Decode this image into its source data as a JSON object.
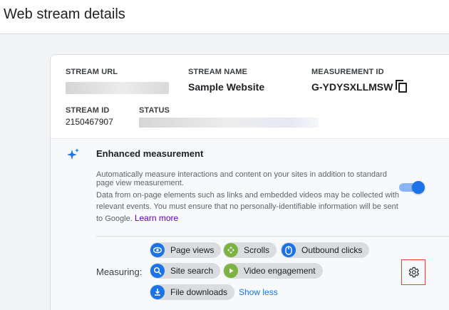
{
  "page": {
    "title": "Web stream details"
  },
  "stream": {
    "url_label": "STREAM URL",
    "name_label": "STREAM NAME",
    "name_value": "Sample Website",
    "measurement_label": "MEASUREMENT ID",
    "measurement_value": "G-YDYSXLLMSW",
    "id_label": "STREAM ID",
    "id_value": "2150467907",
    "status_label": "STATUS"
  },
  "enhanced": {
    "title": "Enhanced measurement",
    "desc1": "Automatically measure interactions and content on your sites in addition to standard page view measurement.",
    "desc2": "Data from on-page elements such as links and embedded videos may be collected with relevant events. You must ensure that no personally-identifiable information will be sent to Google.",
    "learn_more": "Learn more",
    "enabled": true
  },
  "measuring": {
    "label": "Measuring:",
    "chips": [
      {
        "label": "Page views",
        "icon": "eye-icon",
        "color": "#1a73e8"
      },
      {
        "label": "Scrolls",
        "icon": "scroll-icon",
        "color": "#7cb342"
      },
      {
        "label": "Outbound clicks",
        "icon": "mouse-icon",
        "color": "#1a73e8"
      },
      {
        "label": "Site search",
        "icon": "search-icon",
        "color": "#1a73e8"
      },
      {
        "label": "Video engagement",
        "icon": "play-icon",
        "color": "#7cb342"
      },
      {
        "label": "File downloads",
        "icon": "download-icon",
        "color": "#1a73e8"
      }
    ],
    "show_less": "Show less"
  },
  "colors": {
    "accent": "#1a73e8",
    "link": "#6200c4",
    "green": "#7cb342",
    "highlight": "#ea4335"
  }
}
